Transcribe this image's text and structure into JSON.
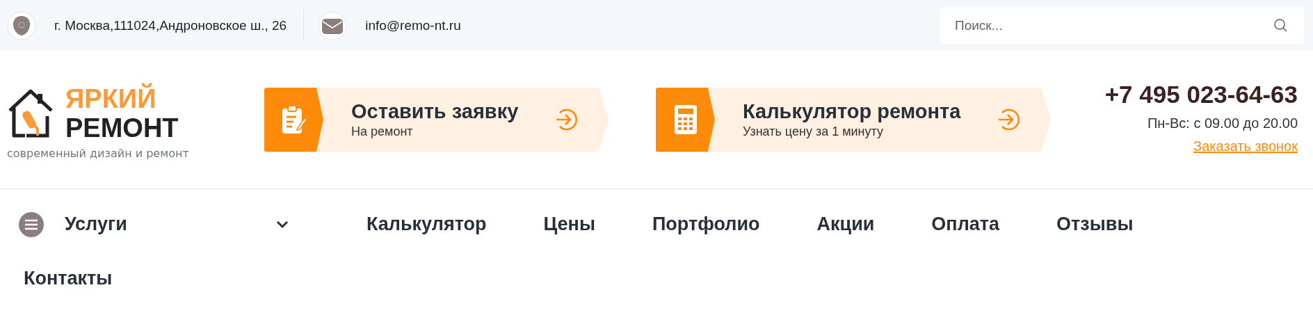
{
  "topbar": {
    "address": "г. Москва,111024,Андроновское ш., 26",
    "email": "info@remo-nt.ru",
    "search": {
      "placeholder": "Поиск..."
    }
  },
  "logo": {
    "line_1": "ЯРКИЙ",
    "line_2": "РЕМОНТ",
    "tagline": "современный дизайн и ремонт"
  },
  "actions": [
    {
      "kind": "form",
      "title": "Оставить заявку",
      "subtitle": "На ремонт"
    },
    {
      "kind": "calculator",
      "title": "Калькулятор ремонта",
      "subtitle": "Узнать цену за 1 минуту"
    }
  ],
  "contact": {
    "phone": "+7 495 023-64-63",
    "hours": "Пн-Вс: с 09.00 до 20.00",
    "callback_link": "Заказать звонок"
  },
  "nav": {
    "services": "Услуги",
    "items": [
      "Калькулятор",
      "Цены",
      "Портфолио",
      "Акции",
      "Оплата",
      "Отзывы"
    ]
  },
  "heading": "Контакты"
}
